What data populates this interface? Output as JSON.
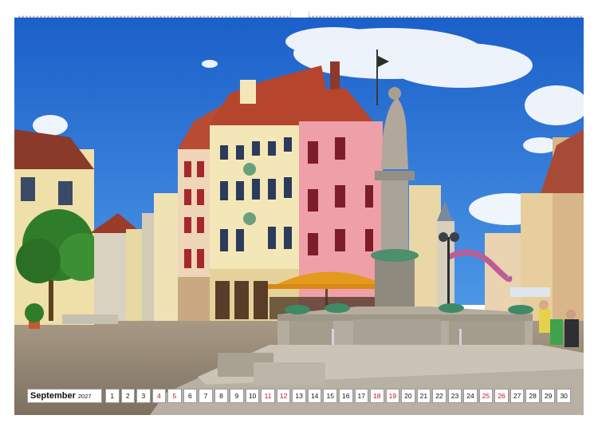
{
  "calendar": {
    "month": "September",
    "year": "2027",
    "days": [
      {
        "d": "1",
        "weekend": false
      },
      {
        "d": "2",
        "weekend": false
      },
      {
        "d": "3",
        "weekend": false
      },
      {
        "d": "4",
        "weekend": true
      },
      {
        "d": "5",
        "weekend": true
      },
      {
        "d": "6",
        "weekend": false
      },
      {
        "d": "7",
        "weekend": false
      },
      {
        "d": "8",
        "weekend": false
      },
      {
        "d": "9",
        "weekend": false
      },
      {
        "d": "10",
        "weekend": false
      },
      {
        "d": "11",
        "weekend": true
      },
      {
        "d": "12",
        "weekend": true
      },
      {
        "d": "13",
        "weekend": false
      },
      {
        "d": "14",
        "weekend": false
      },
      {
        "d": "15",
        "weekend": false
      },
      {
        "d": "16",
        "weekend": false
      },
      {
        "d": "17",
        "weekend": false
      },
      {
        "d": "18",
        "weekend": true
      },
      {
        "d": "19",
        "weekend": true
      },
      {
        "d": "20",
        "weekend": false
      },
      {
        "d": "21",
        "weekend": false
      },
      {
        "d": "22",
        "weekend": false
      },
      {
        "d": "23",
        "weekend": false
      },
      {
        "d": "24",
        "weekend": false
      },
      {
        "d": "25",
        "weekend": true
      },
      {
        "d": "26",
        "weekend": true
      },
      {
        "d": "27",
        "weekend": false
      },
      {
        "d": "28",
        "weekend": false
      },
      {
        "d": "29",
        "weekend": false
      },
      {
        "d": "30",
        "weekend": false
      }
    ]
  },
  "colors": {
    "weekend_day": "#c8102e",
    "weekday": "#111111",
    "sky": "#1f6fd6"
  }
}
